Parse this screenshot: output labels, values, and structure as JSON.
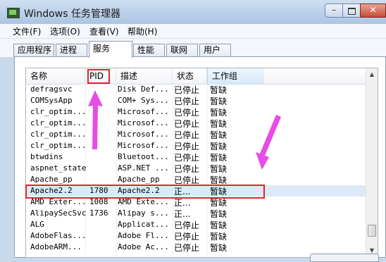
{
  "window": {
    "title": "Windows 任务管理器",
    "min_glyph": "–",
    "close_glyph": "✕"
  },
  "menu": [
    "文件(F)",
    "选项(O)",
    "查看(V)",
    "帮助(H)"
  ],
  "tabs": [
    "应用程序",
    "进程",
    "服务",
    "性能",
    "联网",
    "用户"
  ],
  "active_tab": "服务",
  "columns": {
    "name": "名称",
    "pid": "PID",
    "desc": "描述",
    "status": "状态",
    "group": "工作组"
  },
  "rows": [
    {
      "name": "defragsvc",
      "pid": "",
      "desc": "Disk Def...",
      "status": "已停止",
      "group": "暂缺"
    },
    {
      "name": "COMSysApp",
      "pid": "",
      "desc": "COM+ Sys...",
      "status": "已停止",
      "group": "暂缺"
    },
    {
      "name": "clr_optim...",
      "pid": "",
      "desc": "Microsof...",
      "status": "已停止",
      "group": "暂缺"
    },
    {
      "name": "clr_optim...",
      "pid": "",
      "desc": "Microsof...",
      "status": "已停止",
      "group": "暂缺"
    },
    {
      "name": "clr_optim...",
      "pid": "",
      "desc": "Microsof...",
      "status": "已停止",
      "group": "暂缺"
    },
    {
      "name": "clr_optim...",
      "pid": "",
      "desc": "Microsof...",
      "status": "已停止",
      "group": "暂缺"
    },
    {
      "name": "btwdins",
      "pid": "",
      "desc": "Bluetoot...",
      "status": "已停止",
      "group": "暂缺"
    },
    {
      "name": "aspnet_state",
      "pid": "",
      "desc": "ASP.NET ...",
      "status": "已停止",
      "group": "暂缺"
    },
    {
      "name": "Apache_pp",
      "pid": "",
      "desc": "Apache_pp",
      "status": "已停止",
      "group": "暂缺"
    },
    {
      "name": "Apache2.2",
      "pid": "1780",
      "desc": "Apache2.2",
      "status": "正...",
      "group": "暂缺"
    },
    {
      "name": "AMD Exter...",
      "pid": "1008",
      "desc": "AMD Exte...",
      "status": "正...",
      "group": "暂缺"
    },
    {
      "name": "AlipaySecSvc",
      "pid": "1736",
      "desc": "Alipay s...",
      "status": "正...",
      "group": "暂缺"
    },
    {
      "name": "ALG",
      "pid": "",
      "desc": "Applicat...",
      "status": "已停止",
      "group": "暂缺"
    },
    {
      "name": "AdobeFlas...",
      "pid": "",
      "desc": "Adobe Fl...",
      "status": "已停止",
      "group": "暂缺"
    },
    {
      "name": "AdobeARM...",
      "pid": "",
      "desc": "Adobe Ac...",
      "status": "已停止",
      "group": "暂缺"
    }
  ],
  "selected_row": 9,
  "colors": {
    "highlight": "#e0262b",
    "arrow": "#e84ce6"
  }
}
